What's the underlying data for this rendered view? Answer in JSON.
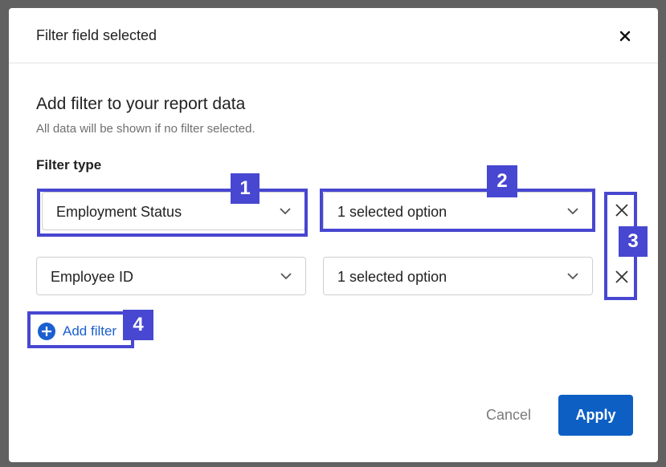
{
  "dialog": {
    "title": "Filter field selected",
    "section_title": "Add filter to your report data",
    "section_subtitle": "All data will be shown if no filter selected.",
    "filter_type_label": "Filter type"
  },
  "filters": [
    {
      "field": "Employment Status",
      "options": "1 selected option"
    },
    {
      "field": "Employee ID",
      "options": "1 selected option"
    }
  ],
  "add_filter_label": "Add filter",
  "buttons": {
    "cancel": "Cancel",
    "apply": "Apply"
  },
  "annotations": [
    "1",
    "2",
    "3",
    "4"
  ],
  "colors": {
    "accent": "#0d5fc4",
    "annotation": "#4747d1",
    "link": "#1a5fd0"
  },
  "icons": {
    "close": "close-icon",
    "chevron": "chevron-down-icon",
    "remove": "remove-x-icon",
    "add": "plus-circle-icon"
  }
}
